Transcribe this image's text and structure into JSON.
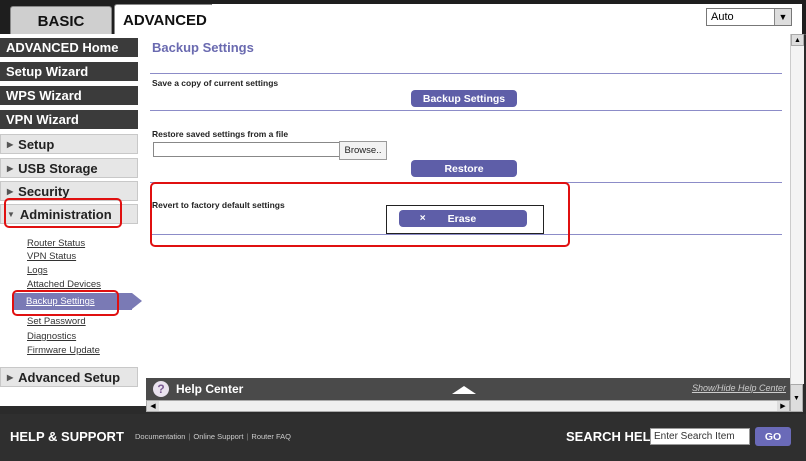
{
  "tabs": {
    "basic": "BASIC",
    "advanced": "ADVANCED"
  },
  "language_select": {
    "value": "Auto"
  },
  "sidebar": {
    "items": [
      {
        "label": "ADVANCED Home",
        "style": "dark"
      },
      {
        "label": "Setup Wizard",
        "style": "dark"
      },
      {
        "label": "WPS Wizard",
        "style": "dark"
      },
      {
        "label": "VPN Wizard",
        "style": "dark"
      },
      {
        "label": "Setup",
        "style": "light"
      },
      {
        "label": "USB Storage",
        "style": "light"
      },
      {
        "label": "Security",
        "style": "light"
      },
      {
        "label": "Administration",
        "style": "light",
        "expanded": true
      },
      {
        "label": "Advanced Setup",
        "style": "light"
      }
    ],
    "administration_sub": [
      "Router Status",
      "VPN Status",
      "Logs",
      "Attached Devices",
      "Backup Settings",
      "Set Password",
      "Diagnostics",
      "Firmware Update"
    ],
    "active_sub": "Backup Settings"
  },
  "main": {
    "title": "Backup Settings",
    "backup": {
      "label": "Save a copy of current settings",
      "button": "Backup Settings"
    },
    "restore": {
      "label": "Restore saved settings from a file",
      "browse": "Browse..",
      "button": "Restore"
    },
    "revert": {
      "label": "Revert to factory default settings",
      "button": "Erase",
      "button_icon": "×"
    }
  },
  "help_center": {
    "title": "Help Center",
    "toggle": "Show/Hide Help Center",
    "icon": "?"
  },
  "footer": {
    "title": "HELP & SUPPORT",
    "links": [
      "Documentation",
      "Online Support",
      "Router FAQ"
    ],
    "search_label": "SEARCH HELP",
    "search_placeholder": "Enter Search Item",
    "go": "GO"
  },
  "colors": {
    "accent": "#5e5ea8",
    "highlight": "#e01010"
  }
}
